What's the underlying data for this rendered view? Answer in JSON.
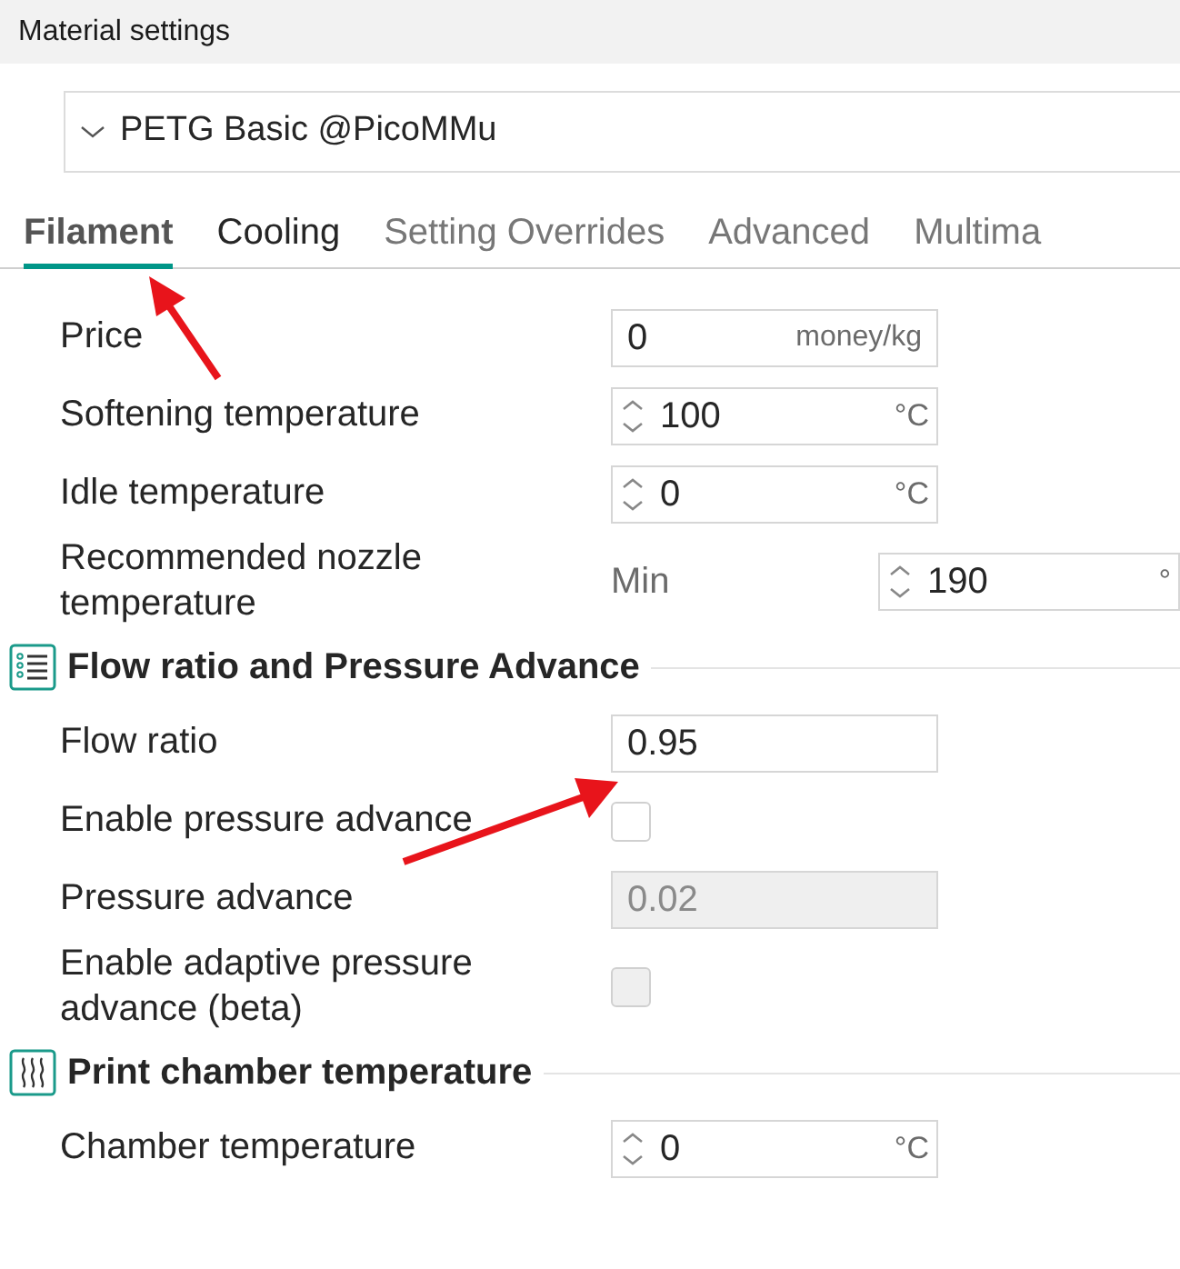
{
  "window": {
    "title": "Material settings"
  },
  "preset": {
    "value": "PETG Basic @PicoMMu"
  },
  "tabs": [
    {
      "label": "Filament",
      "selected": true,
      "disabled": false
    },
    {
      "label": "Cooling",
      "selected": false,
      "disabled": false
    },
    {
      "label": "Setting Overrides",
      "selected": false,
      "disabled": true
    },
    {
      "label": "Advanced",
      "selected": false,
      "disabled": true
    },
    {
      "label": "Multima",
      "selected": false,
      "disabled": true
    }
  ],
  "sections": [
    {
      "rows": [
        {
          "kind": "text",
          "label": "Price",
          "value": "0",
          "unit": "money/kg",
          "disabled": false
        },
        {
          "kind": "spin",
          "label": "Softening temperature",
          "value": "100",
          "unit": "°C"
        },
        {
          "kind": "spin",
          "label": "Idle temperature",
          "value": "0",
          "unit": "°C"
        },
        {
          "kind": "range",
          "label": "Recommended nozzle temperature",
          "sublabel": "Min",
          "value": "190",
          "unit": "°"
        }
      ]
    },
    {
      "title": "Flow ratio and Pressure Advance",
      "rows": [
        {
          "kind": "text",
          "label": "Flow ratio",
          "value": "0.95",
          "disabled": false
        },
        {
          "kind": "checkbox",
          "label": "Enable pressure advance",
          "checked": false,
          "disabled": false
        },
        {
          "kind": "text",
          "label": "Pressure advance",
          "value": "0.02",
          "disabled": true
        },
        {
          "kind": "checkbox",
          "label": "Enable adaptive pressure advance (beta)",
          "checked": false,
          "disabled": true
        }
      ]
    },
    {
      "title": "Print chamber temperature",
      "rows": [
        {
          "kind": "spin",
          "label": "Chamber temperature",
          "value": "0",
          "unit": "°C"
        }
      ]
    }
  ]
}
